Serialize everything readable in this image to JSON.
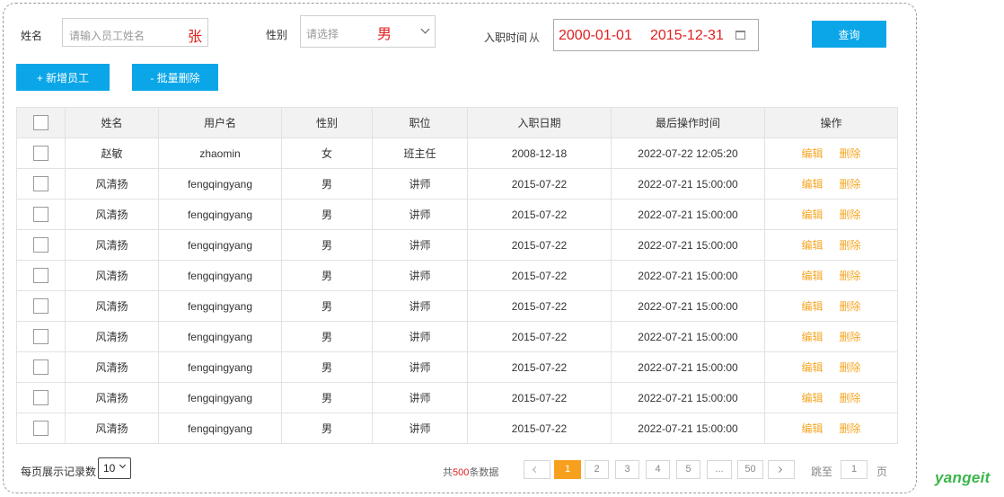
{
  "filters": {
    "name_label": "姓名",
    "name_placeholder": "请输入员工姓名",
    "name_value": "张",
    "gender_label": "性别",
    "gender_placeholder": "请选择",
    "gender_value": "男",
    "date_label": "入职时间",
    "date_from_text": "从",
    "date_start": "2000-01-01",
    "date_end": "2015-12-31",
    "search_label": "查询"
  },
  "actions": {
    "add_label": "+ 新增员工",
    "batch_delete_label": "- 批量删除"
  },
  "table": {
    "headers": [
      "姓名",
      "用户名",
      "性别",
      "职位",
      "入职日期",
      "最后操作时间",
      "操作"
    ],
    "edit_label": "编辑",
    "delete_label": "删除",
    "rows": [
      {
        "name": "赵敏",
        "username": "zhaomin",
        "gender": "女",
        "position": "班主任",
        "hire_date": "2008-12-18",
        "last_op": "2022-07-22 12:05:20"
      },
      {
        "name": "风清扬",
        "username": "fengqingyang",
        "gender": "男",
        "position": "讲师",
        "hire_date": "2015-07-22",
        "last_op": "2022-07-21 15:00:00"
      },
      {
        "name": "风清扬",
        "username": "fengqingyang",
        "gender": "男",
        "position": "讲师",
        "hire_date": "2015-07-22",
        "last_op": "2022-07-21 15:00:00"
      },
      {
        "name": "风清扬",
        "username": "fengqingyang",
        "gender": "男",
        "position": "讲师",
        "hire_date": "2015-07-22",
        "last_op": "2022-07-21 15:00:00"
      },
      {
        "name": "风清扬",
        "username": "fengqingyang",
        "gender": "男",
        "position": "讲师",
        "hire_date": "2015-07-22",
        "last_op": "2022-07-21 15:00:00"
      },
      {
        "name": "风清扬",
        "username": "fengqingyang",
        "gender": "男",
        "position": "讲师",
        "hire_date": "2015-07-22",
        "last_op": "2022-07-21 15:00:00"
      },
      {
        "name": "风清扬",
        "username": "fengqingyang",
        "gender": "男",
        "position": "讲师",
        "hire_date": "2015-07-22",
        "last_op": "2022-07-21 15:00:00"
      },
      {
        "name": "风清扬",
        "username": "fengqingyang",
        "gender": "男",
        "position": "讲师",
        "hire_date": "2015-07-22",
        "last_op": "2022-07-21 15:00:00"
      },
      {
        "name": "风清扬",
        "username": "fengqingyang",
        "gender": "男",
        "position": "讲师",
        "hire_date": "2015-07-22",
        "last_op": "2022-07-21 15:00:00"
      },
      {
        "name": "风清扬",
        "username": "fengqingyang",
        "gender": "男",
        "position": "讲师",
        "hire_date": "2015-07-22",
        "last_op": "2022-07-21 15:00:00"
      }
    ]
  },
  "pagination": {
    "page_size_label": "每页展示记录数",
    "page_size_value": "10",
    "total_prefix": "共",
    "total_count": "500",
    "total_suffix": "条数据",
    "pages": [
      "1",
      "2",
      "3",
      "4",
      "5",
      "...",
      "50"
    ],
    "current_page": "1",
    "jump_label": "跳至",
    "jump_value": "1",
    "page_unit": "页"
  },
  "brand": "yangeit",
  "colors": {
    "accent_blue": "#0aa6e8",
    "action_orange": "#f5a623",
    "active_page": "#f7a01d",
    "value_red": "#e02020",
    "brand_green": "#3ab54a"
  }
}
